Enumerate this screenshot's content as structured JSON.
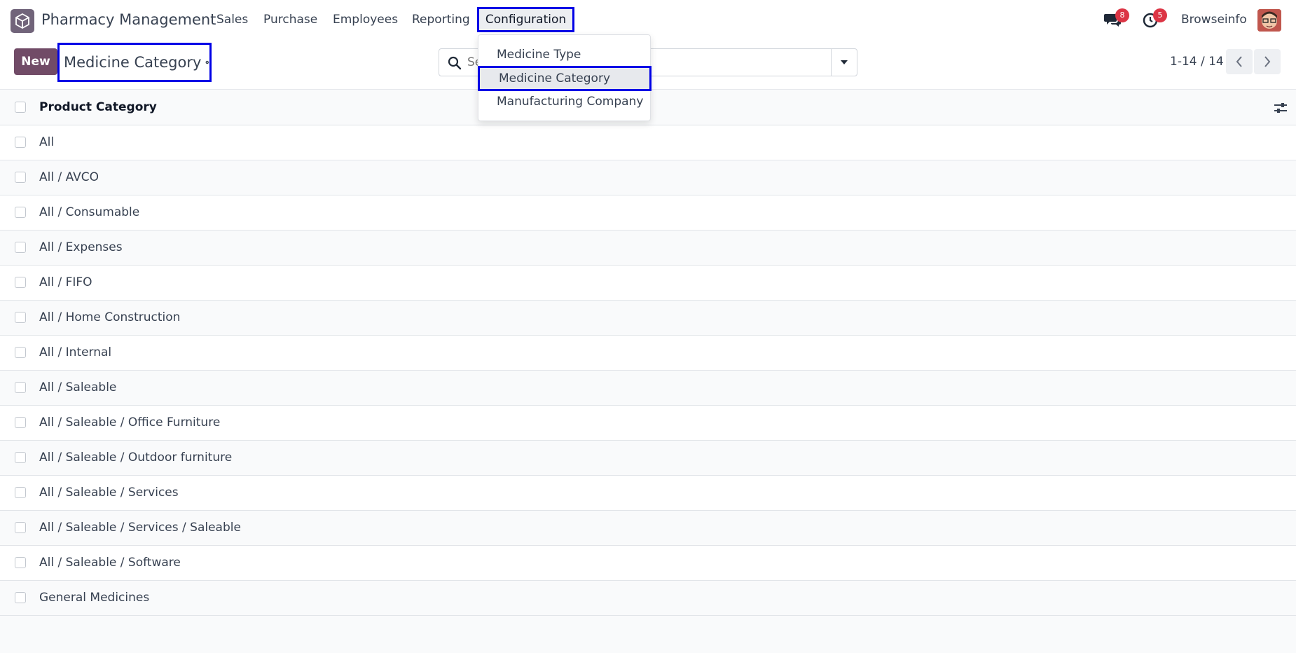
{
  "navbar": {
    "app_name": "Pharmacy Management",
    "menu": [
      "Sales",
      "Purchase",
      "Employees",
      "Reporting"
    ],
    "active_menu": "Configuration",
    "messages_count": "8",
    "activities_count": "5",
    "user_name": "Browseinfo"
  },
  "config_dropdown": {
    "items": [
      "Medicine Type",
      "Medicine Category",
      "Manufacturing Company"
    ],
    "active_item": "Medicine Category"
  },
  "control_panel": {
    "new_label": "New",
    "breadcrumb_title": "Medicine Category",
    "search_placeholder": "Search...",
    "pager": "1-14 / 14"
  },
  "list": {
    "column_header": "Product Category",
    "rows": [
      "All",
      "All / AVCO",
      "All / Consumable",
      "All / Expenses",
      "All / FIFO",
      "All / Home Construction",
      "All / Internal",
      "All / Saleable",
      "All / Saleable / Office Furniture",
      "All / Saleable / Outdoor furniture",
      "All / Saleable / Services",
      "All / Saleable / Services / Saleable",
      "All / Saleable / Software",
      "General Medicines"
    ]
  },
  "colors": {
    "brand": "#714b67",
    "highlight_border": "#0000e6",
    "badge": "#dc3545"
  }
}
